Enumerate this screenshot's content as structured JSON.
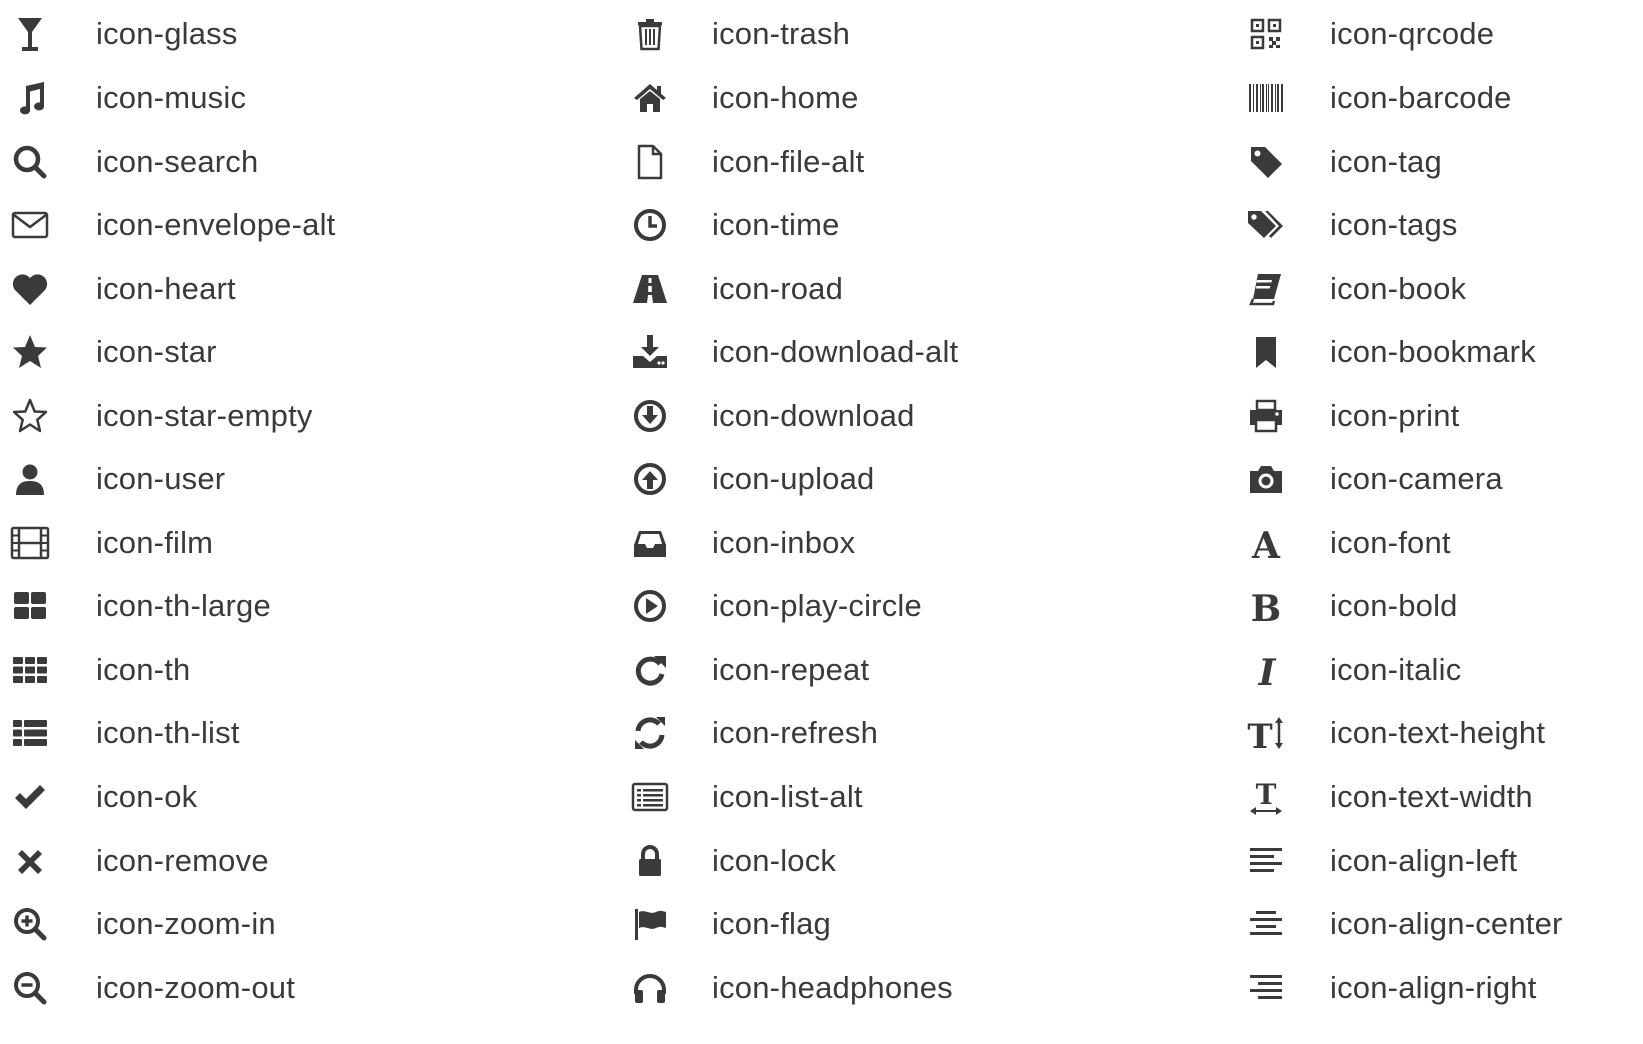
{
  "columns": [
    {
      "items": [
        {
          "label": "icon-glass",
          "icon": "glass-icon"
        },
        {
          "label": "icon-music",
          "icon": "music-icon"
        },
        {
          "label": "icon-search",
          "icon": "search-icon"
        },
        {
          "label": "icon-envelope-alt",
          "icon": "envelope-icon"
        },
        {
          "label": "icon-heart",
          "icon": "heart-icon"
        },
        {
          "label": "icon-star",
          "icon": "star-icon"
        },
        {
          "label": "icon-star-empty",
          "icon": "star-empty-icon"
        },
        {
          "label": "icon-user",
          "icon": "user-icon"
        },
        {
          "label": "icon-film",
          "icon": "film-icon"
        },
        {
          "label": "icon-th-large",
          "icon": "th-large-icon"
        },
        {
          "label": "icon-th",
          "icon": "th-icon"
        },
        {
          "label": "icon-th-list",
          "icon": "th-list-icon"
        },
        {
          "label": "icon-ok",
          "icon": "ok-icon"
        },
        {
          "label": "icon-remove",
          "icon": "remove-icon"
        },
        {
          "label": "icon-zoom-in",
          "icon": "zoom-in-icon"
        },
        {
          "label": "icon-zoom-out",
          "icon": "zoom-out-icon"
        }
      ]
    },
    {
      "items": [
        {
          "label": "icon-trash",
          "icon": "trash-icon"
        },
        {
          "label": "icon-home",
          "icon": "home-icon"
        },
        {
          "label": "icon-file-alt",
          "icon": "file-icon"
        },
        {
          "label": "icon-time",
          "icon": "clock-icon"
        },
        {
          "label": "icon-road",
          "icon": "road-icon"
        },
        {
          "label": "icon-download-alt",
          "icon": "download-alt-icon"
        },
        {
          "label": "icon-download",
          "icon": "download-icon"
        },
        {
          "label": "icon-upload",
          "icon": "upload-icon"
        },
        {
          "label": "icon-inbox",
          "icon": "inbox-icon"
        },
        {
          "label": "icon-play-circle",
          "icon": "play-circle-icon"
        },
        {
          "label": "icon-repeat",
          "icon": "repeat-icon"
        },
        {
          "label": "icon-refresh",
          "icon": "refresh-icon"
        },
        {
          "label": "icon-list-alt",
          "icon": "list-alt-icon"
        },
        {
          "label": "icon-lock",
          "icon": "lock-icon"
        },
        {
          "label": "icon-flag",
          "icon": "flag-icon"
        },
        {
          "label": "icon-headphones",
          "icon": "headphones-icon"
        }
      ]
    },
    {
      "items": [
        {
          "label": "icon-qrcode",
          "icon": "qrcode-icon"
        },
        {
          "label": "icon-barcode",
          "icon": "barcode-icon"
        },
        {
          "label": "icon-tag",
          "icon": "tag-icon"
        },
        {
          "label": "icon-tags",
          "icon": "tags-icon"
        },
        {
          "label": "icon-book",
          "icon": "book-icon"
        },
        {
          "label": "icon-bookmark",
          "icon": "bookmark-icon"
        },
        {
          "label": "icon-print",
          "icon": "print-icon"
        },
        {
          "label": "icon-camera",
          "icon": "camera-icon"
        },
        {
          "label": "icon-font",
          "icon": "font-icon"
        },
        {
          "label": "icon-bold",
          "icon": "bold-icon"
        },
        {
          "label": "icon-italic",
          "icon": "italic-icon"
        },
        {
          "label": "icon-text-height",
          "icon": "text-height-icon"
        },
        {
          "label": "icon-text-width",
          "icon": "text-width-icon"
        },
        {
          "label": "icon-align-left",
          "icon": "align-left-icon"
        },
        {
          "label": "icon-align-center",
          "icon": "align-center-icon"
        },
        {
          "label": "icon-align-right",
          "icon": "align-right-icon"
        }
      ]
    }
  ],
  "colors": {
    "icon": "#3a3a3a",
    "text": "#3a3a3a",
    "background": "#ffffff"
  }
}
